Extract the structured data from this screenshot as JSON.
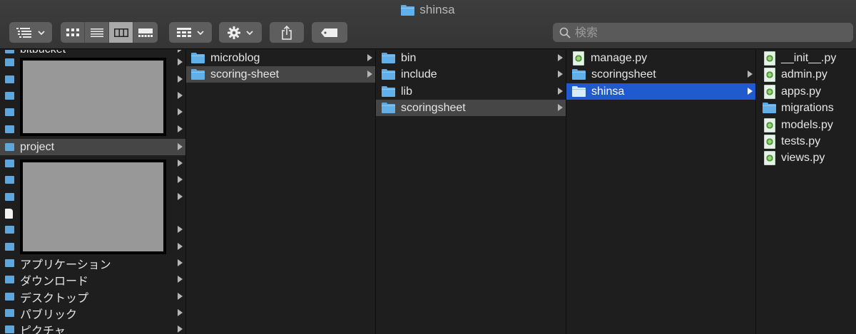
{
  "window": {
    "title": "shinsa"
  },
  "toolbar": {
    "search_placeholder": "検索",
    "icons": [
      "sidebar-list-icon",
      "icon-view-icon",
      "list-view-icon",
      "column-view-icon",
      "gallery-view-icon",
      "group-icon",
      "gear-icon",
      "share-icon",
      "tag-icon"
    ]
  },
  "sidebar": {
    "items": [
      {
        "label": "bitbucket",
        "icon": "folder"
      },
      {
        "label": "",
        "icon": "folder"
      },
      {
        "label": "",
        "icon": "folder"
      },
      {
        "label": "",
        "icon": "folder"
      },
      {
        "label": "",
        "icon": "folder"
      },
      {
        "label": "",
        "icon": "folder"
      },
      {
        "label": "project",
        "icon": "folder"
      },
      {
        "label": "",
        "icon": "folder"
      },
      {
        "label": "",
        "icon": "folder"
      },
      {
        "label": "",
        "icon": "folder"
      },
      {
        "label": "",
        "icon": "document"
      },
      {
        "label": "",
        "icon": "folder"
      },
      {
        "label": "",
        "icon": "folder"
      },
      {
        "label": "アプリケーション",
        "icon": "app"
      },
      {
        "label": "ダウンロード",
        "icon": "folder"
      },
      {
        "label": "デスクトップ",
        "icon": "folder"
      },
      {
        "label": "パブリック",
        "icon": "folder"
      },
      {
        "label": "ピクチャ",
        "icon": "folder"
      }
    ]
  },
  "col1": {
    "items": [
      {
        "label": "microblog"
      },
      {
        "label": "scoring-sheet"
      }
    ]
  },
  "col2": {
    "items": [
      {
        "label": "bin"
      },
      {
        "label": "include"
      },
      {
        "label": "lib"
      },
      {
        "label": "scoringsheet"
      }
    ]
  },
  "col3": {
    "items": [
      {
        "label": "manage.py"
      },
      {
        "label": "scoringsheet"
      },
      {
        "label": "shinsa"
      }
    ]
  },
  "col4": {
    "items": [
      {
        "label": "__init__.py"
      },
      {
        "label": "admin.py"
      },
      {
        "label": "apps.py"
      },
      {
        "label": "migrations"
      },
      {
        "label": "models.py"
      },
      {
        "label": "tests.py"
      },
      {
        "label": "views.py"
      }
    ]
  },
  "colors": {
    "selection_blue": "#1f5bcf",
    "selection_gray": "#464646",
    "folder_blue": "#62b0ea"
  }
}
